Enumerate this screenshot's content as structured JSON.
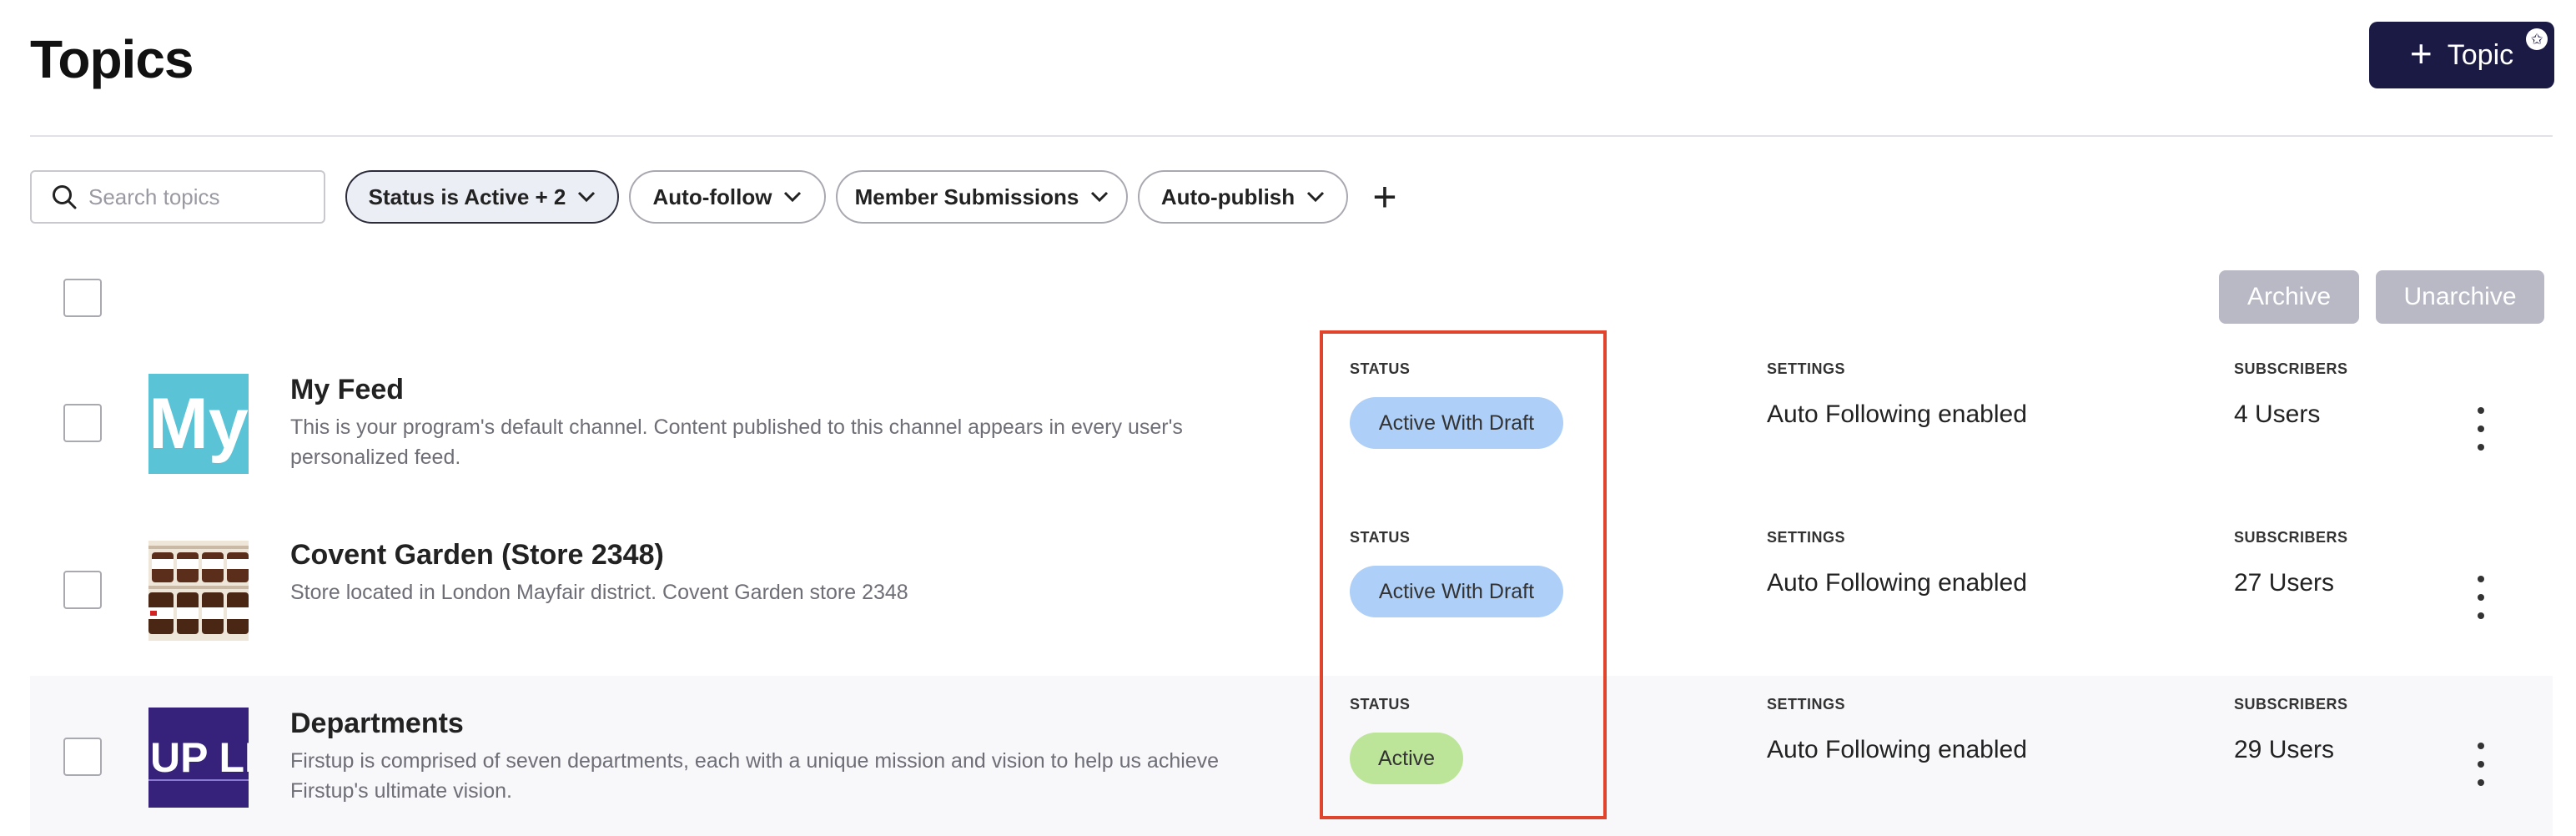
{
  "page": {
    "title": "Topics",
    "add_button_label": "Topic",
    "add_button_plus": "+",
    "add_button_badge": "✩"
  },
  "filters": {
    "search_placeholder": "Search topics",
    "status_prefix": "Status",
    "status_value": "is Active + 2",
    "auto_follow": "Auto-follow",
    "member_submissions": "Member Submissions",
    "auto_publish": "Auto-publish",
    "add_filter": "+"
  },
  "bulk_actions": {
    "archive": "Archive",
    "unarchive": "Unarchive"
  },
  "columns": {
    "status": "STATUS",
    "settings": "SETTINGS",
    "subscribers": "SUBSCRIBERS"
  },
  "topics": [
    {
      "name": "My Feed",
      "description": "This is your program's default channel. Content published to this channel appears in every user's personalized feed.",
      "thumb_text": "My",
      "status": "Active With Draft",
      "settings": "Auto Following enabled",
      "subscribers": "4 Users"
    },
    {
      "name": "Covent Garden (Store 2348)",
      "description": "Store located in London Mayfair district. Covent Garden store 2348",
      "thumb_text": "",
      "status": "Active With Draft",
      "settings": "Auto Following enabled",
      "subscribers": "27 Users"
    },
    {
      "name": "Departments",
      "description": "Firstup is comprised of seven departments, each with a unique mission and vision to help us achieve Firstup's ultimate vision.",
      "thumb_text": "UP LI",
      "status": "Active",
      "settings": "Auto Following enabled",
      "subscribers": "29 Users"
    }
  ],
  "colors": {
    "primary_button": "#1b1a45",
    "status_draft": "#aecff7",
    "status_active": "#bde59a",
    "highlight_border": "#e0442c",
    "disabled_button": "#b8b9c5"
  }
}
